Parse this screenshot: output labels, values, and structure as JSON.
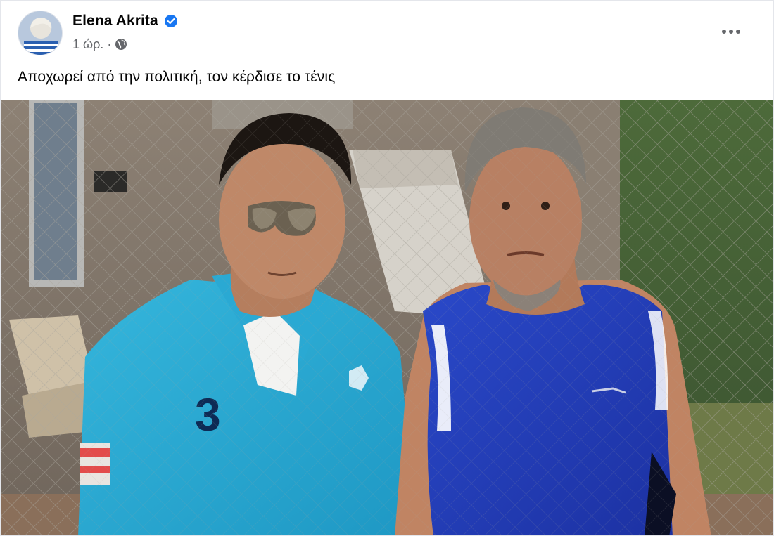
{
  "post": {
    "author": "Elena Akrita",
    "verified_icon": "verified-badge-icon",
    "time": "1 ώρ.",
    "separator": "·",
    "audience_icon": "globe-icon",
    "more_icon": "more-options-icon",
    "caption": "Αποχωρεί από την πολιτική, τον κέρδισε το τένις",
    "photo_number": "3"
  },
  "colors": {
    "verified": "#1877f2",
    "secondary_text": "#65676b",
    "primary_text": "#050505"
  }
}
